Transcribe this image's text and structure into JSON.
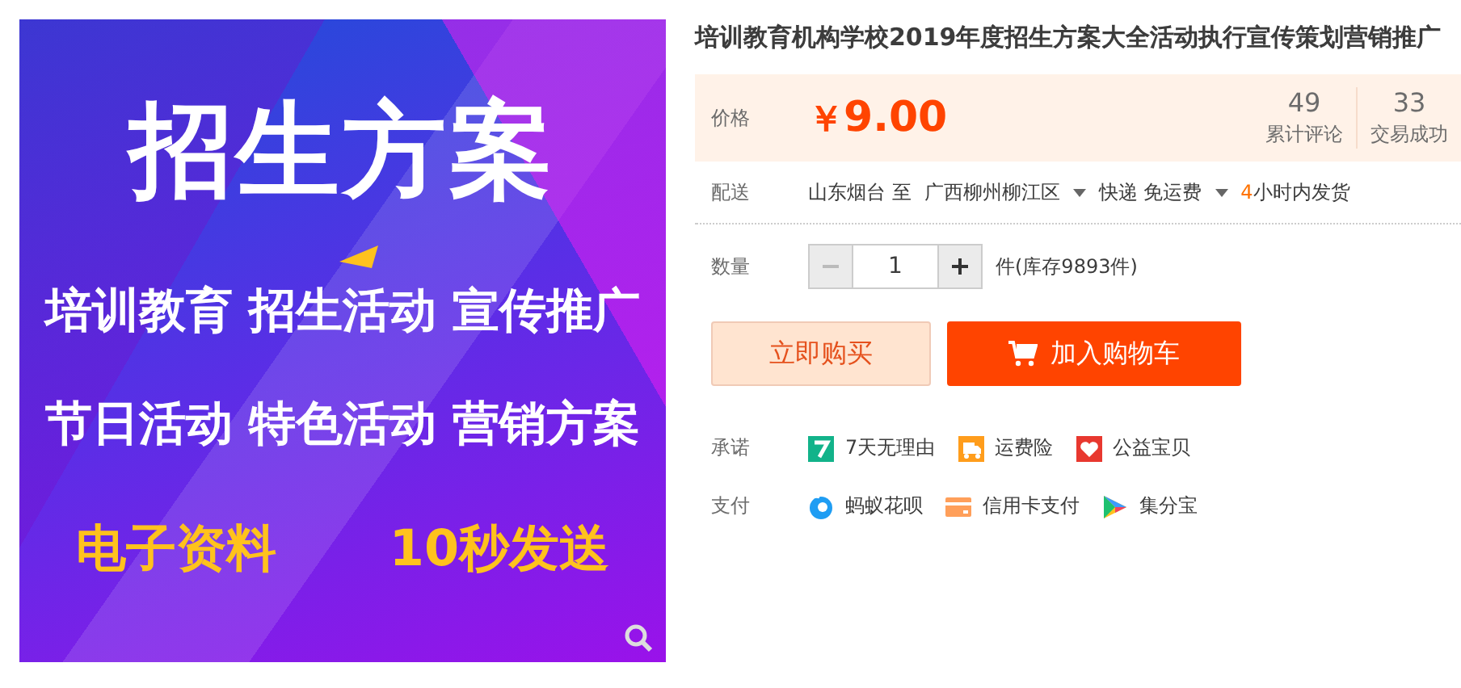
{
  "product_image": {
    "headline": "招生方案",
    "lines": [
      "培训教育 招生活动 宣传推广",
      "节日活动 特色活动 营销方案"
    ],
    "footer": [
      "电子资料",
      "10秒发送"
    ]
  },
  "title": "培训教育机构学校2019年度招生方案大全活动执行宣传策划营销推广",
  "price": {
    "label": "价格",
    "currency": "￥",
    "amount": "9.00"
  },
  "stats": [
    {
      "value": "49",
      "label": "累计评论"
    },
    {
      "value": "33",
      "label": "交易成功"
    }
  ],
  "delivery": {
    "label": "配送",
    "from": "山东烟台 至",
    "to": "广西柳州柳江区",
    "shipping": "快递 免运费",
    "dispatch_hours": "4",
    "dispatch_text": "小时内发货"
  },
  "quantity": {
    "label": "数量",
    "value": "1",
    "stock": "件(库存9893件)",
    "decrease_disabled": true
  },
  "buttons": [
    {
      "kind": "buy",
      "label": "立即购买"
    },
    {
      "kind": "cart",
      "label": "加入购物车"
    }
  ],
  "promises": {
    "label": "承诺",
    "items": [
      {
        "kind": "seven-day",
        "label": "7天无理由"
      },
      {
        "kind": "freight",
        "label": "运费险"
      },
      {
        "kind": "charity",
        "label": "公益宝贝"
      }
    ]
  },
  "payment": {
    "label": "支付",
    "items": [
      {
        "kind": "huabei",
        "label": "蚂蚁花呗"
      },
      {
        "kind": "card",
        "label": "信用卡支付"
      },
      {
        "kind": "points",
        "label": "集分宝"
      }
    ]
  }
}
